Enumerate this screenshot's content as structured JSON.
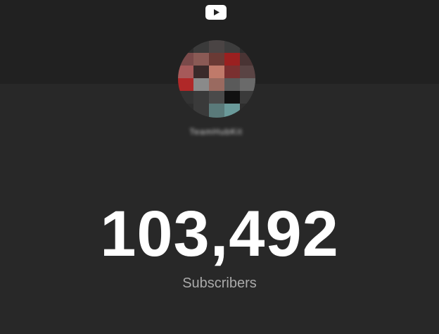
{
  "header": {
    "logo_icon": "youtube-play-icon"
  },
  "channel": {
    "avatar_icon": "channel-avatar-icon",
    "name": "TeamHubKit"
  },
  "stats": {
    "subscriber_count": "103,492",
    "subscriber_label": "Subscribers"
  },
  "colors": {
    "background": "#282828",
    "header_band": "#212121",
    "count_text": "#ffffff",
    "label_text": "#aaaaaa"
  }
}
